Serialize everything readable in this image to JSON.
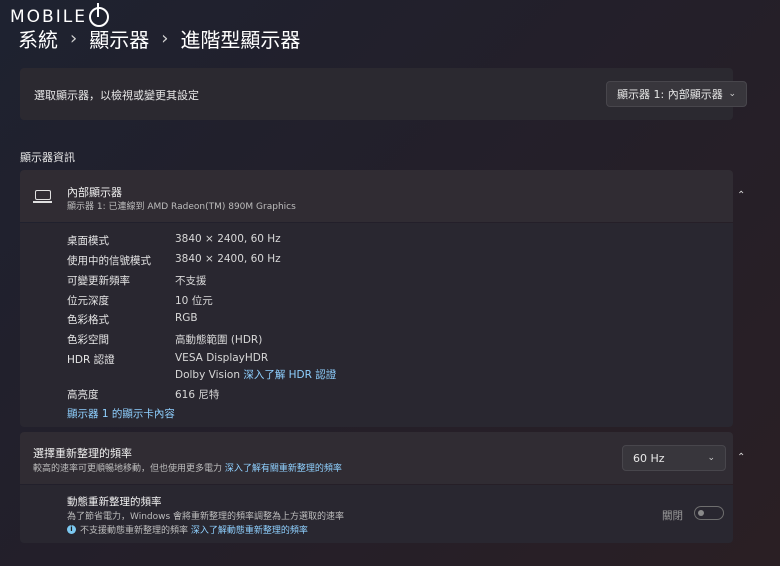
{
  "logo": {
    "text": "MOBILE"
  },
  "breadcrumb": {
    "items": [
      "系統",
      "顯示器",
      "進階型顯示器"
    ]
  },
  "select_display": {
    "label": "選取顯示器，以檢視或變更其設定",
    "selected": "顯示器 1: 內部顯示器"
  },
  "section_title": "顯示器資訊",
  "display_info": {
    "name": "內部顯示器",
    "subtitle": "顯示器 1: 已連線到 AMD Radeon(TM) 890M Graphics",
    "rows": [
      {
        "label": "桌面模式",
        "value": "3840 × 2400, 60 Hz"
      },
      {
        "label": "使用中的信號模式",
        "value": "3840 × 2400, 60 Hz"
      },
      {
        "label": "可變更新頻率",
        "value": "不支援"
      },
      {
        "label": "位元深度",
        "value": "10 位元"
      },
      {
        "label": "色彩格式",
        "value": "RGB"
      },
      {
        "label": "色彩空間",
        "value": "高動態範圍 (HDR)"
      },
      {
        "label": "HDR 認證",
        "value": "VESA DisplayHDR"
      },
      {
        "label": "高亮度",
        "value": "616 尼特"
      }
    ],
    "hdr_line2": "Dolby Vision",
    "hdr_link": "深入了解 HDR 認證",
    "adapter_link": "顯示器 1 的顯示卡內容"
  },
  "refresh": {
    "title": "選擇重新整理的頻率",
    "desc": "較高的速率可更順暢地移動，但也使用更多電力",
    "link": "深入了解有關重新整理的頻率",
    "selected": "60 Hz"
  },
  "dynamic": {
    "title": "動態重新整理的頻率",
    "desc": "為了節省電力，Windows 會將重新整理的頻率調整為上方選取的速率",
    "note": "不支援動態重新整理的頻率",
    "note_link": "深入了解動態重新整理的頻率",
    "toggle_label": "關閉",
    "toggle_on": false
  },
  "icons": {
    "chevron_down": "⌄",
    "chevron_up": "⌃",
    "breadcrumb_sep": "›"
  }
}
